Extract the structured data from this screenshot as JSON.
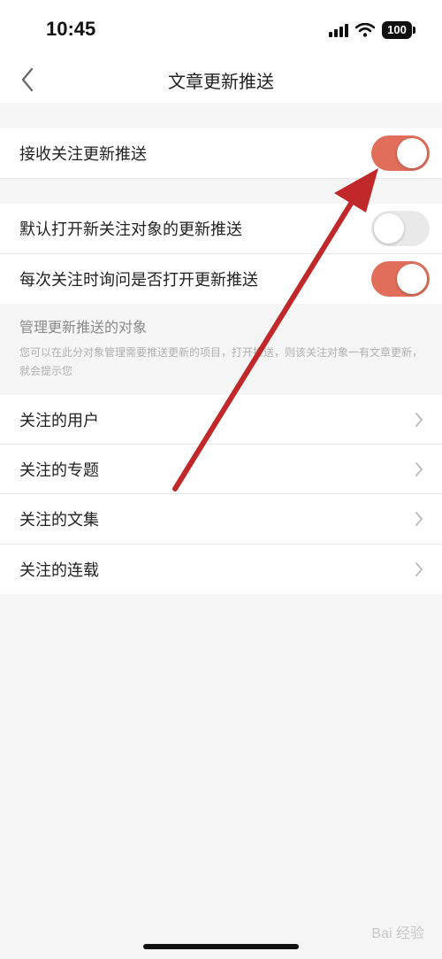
{
  "status_bar": {
    "time": "10:45",
    "battery": "100",
    "icons": [
      "signal-icon",
      "wifi-icon",
      "battery-icon"
    ]
  },
  "nav": {
    "title": "文章更新推送",
    "back_icon": "chevron-left-icon"
  },
  "settings": {
    "receive_push": {
      "label": "接收关注更新推送",
      "enabled": true
    },
    "default_open": {
      "label": "默认打开新关注对象的更新推送",
      "enabled": false
    },
    "ask_each_time": {
      "label": "每次关注时询问是否打开更新推送",
      "enabled": true
    }
  },
  "manage": {
    "title": "管理更新推送的对象",
    "description": "您可以在此分对象管理需要推送更新的项目，打开推送，则该关注对象一有文章更新，就会提示您",
    "items": [
      {
        "label": "关注的用户"
      },
      {
        "label": "关注的专题"
      },
      {
        "label": "关注的文集"
      },
      {
        "label": "关注的连载"
      }
    ]
  },
  "colors": {
    "toggle_on": "#e06e5b",
    "toggle_off": "#e9e9ea",
    "annotation_arrow": "#c0282a",
    "background": "#f5f5f5"
  },
  "watermark": "Bai 经验"
}
